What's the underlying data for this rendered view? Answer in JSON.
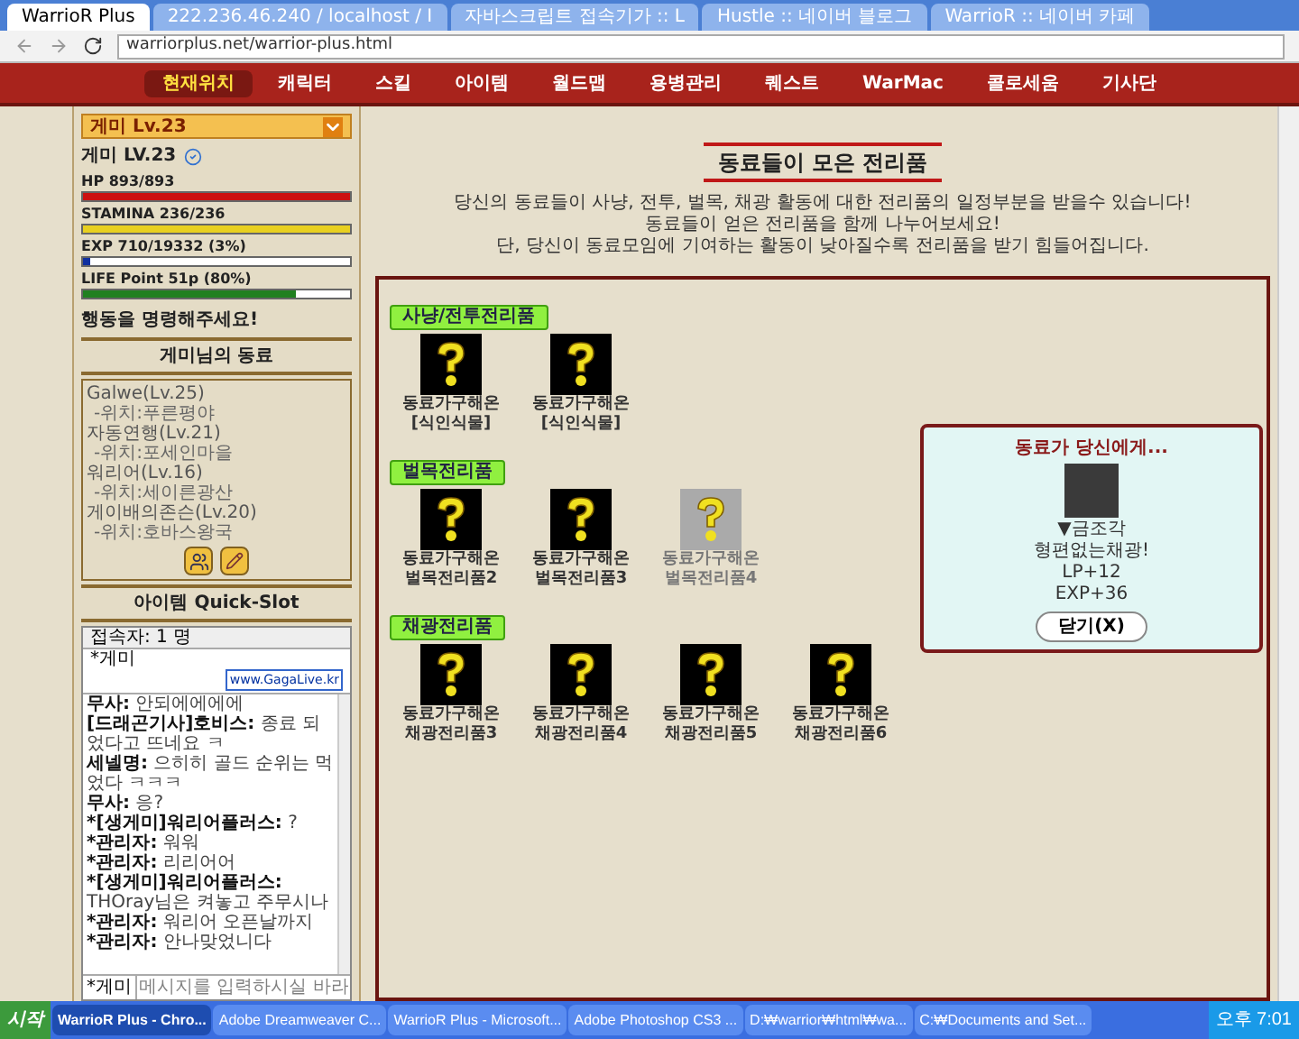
{
  "browser": {
    "tabs": [
      {
        "label": "WarrioR Plus",
        "selected": true
      },
      {
        "label": "222.236.46.240 / localhost / I",
        "selected": false
      },
      {
        "label": "자바스크립트 접속기가 :: L",
        "selected": false
      },
      {
        "label": "Hustle :: 네이버 블로그",
        "selected": false
      },
      {
        "label": "WarrioR :: 네이버 카페",
        "selected": false
      }
    ],
    "address": "warriorplus.net/warrior-plus.html"
  },
  "nav": [
    {
      "label": "현재위치",
      "selected": true
    },
    {
      "label": "캐릭터",
      "selected": false
    },
    {
      "label": "스킬",
      "selected": false
    },
    {
      "label": "아이템",
      "selected": false
    },
    {
      "label": "월드맵",
      "selected": false
    },
    {
      "label": "용병관리",
      "selected": false
    },
    {
      "label": "퀘스트",
      "selected": false
    },
    {
      "label": "WarMac",
      "selected": false
    },
    {
      "label": "콜로세움",
      "selected": false
    },
    {
      "label": "기사단",
      "selected": false
    }
  ],
  "sidebar": {
    "character_select": "게미 Lv.23",
    "name": "게미 LV.23",
    "stats": [
      {
        "label": "HP 893/893",
        "level": 1,
        "color": "#cc1010"
      },
      {
        "label": "STAMINA 236/236",
        "level": 1,
        "color": "#e8d020"
      },
      {
        "label": "EXP 710/19332 (3%)",
        "level": 0.03,
        "color": "#1030a0"
      },
      {
        "label": "LIFE Point 51p (80%)",
        "level": 0.8,
        "color": "#208020"
      }
    ],
    "command": "행동을 명령해주세요!",
    "companions_title": "게미님의 동료",
    "companions": [
      {
        "name": "Galwe(Lv.25)",
        "location": "-위치:푸른평야"
      },
      {
        "name": "자동연행(Lv.21)",
        "location": "-위치:포세인마을"
      },
      {
        "name": "워리어(Lv.16)",
        "location": "-위치:세이른광산"
      },
      {
        "name": "게이배의존슨(Lv.20)",
        "location": "-위치:호바스왕국"
      }
    ],
    "quickslot_title": "아이템 Quick-Slot",
    "chat": {
      "users_count": "접속자: 1 명",
      "users": [
        "*게미"
      ],
      "badge": "www.GagaLive.kr",
      "messages": [
        {
          "name": "무사:",
          "text": "안되에에에에"
        },
        {
          "name": "[드래곤기사]호비스:",
          "text": "종료 되었다고 뜨네요 ㅋ"
        },
        {
          "name": "세넬명:",
          "text": "으히히 골드 순위는 먹었다 ㅋㅋㅋ"
        },
        {
          "name": "무사:",
          "text": "응?"
        },
        {
          "name": "*[생게미]워리어플러스:",
          "text": "?"
        },
        {
          "name": "*관리자:",
          "text": "워워"
        },
        {
          "name": "*관리자:",
          "text": "리리어어"
        },
        {
          "name": "*[생게미]워리어플러스:",
          "text": "THOray님은 켜놓고 주무시나"
        },
        {
          "name": "*관리자:",
          "text": "워리어 오픈날까지"
        },
        {
          "name": "*관리자:",
          "text": "안나맞었니다"
        }
      ],
      "nick": "*게미",
      "placeholder": "메시지를 입력하시실 바라"
    }
  },
  "main": {
    "title": "동료들이 모은 전리품",
    "description": [
      "당신의 동료들이 사냥, 전투, 벌목, 채광 활동에 대한 전리품의 일정부분을 받을수 있습니다!",
      "동료들이 얻은 전리품을 함께 나누어보세요!",
      "단, 당신이 동료모임에 기여하는 활동이 낮아질수록 전리품을 받기 힘들어집니다."
    ],
    "sections": [
      {
        "title": "사냥/전투전리품",
        "items": [
          {
            "line1": "동료가구해온",
            "line2": "[식인식물]",
            "dimmed": false
          },
          {
            "line1": "동료가구해온",
            "line2": "[식인식물]",
            "dimmed": false
          }
        ]
      },
      {
        "title": "벌목전리품",
        "items": [
          {
            "line1": "동료가구해온",
            "line2": "벌목전리품2",
            "dimmed": false
          },
          {
            "line1": "동료가구해온",
            "line2": "벌목전리품3",
            "dimmed": false
          },
          {
            "line1": "동료가구해온",
            "line2": "벌목전리품4",
            "dimmed": true
          }
        ]
      },
      {
        "title": "채광전리품",
        "items": [
          {
            "line1": "동료가구해온",
            "line2": "채광전리품3",
            "dimmed": false
          },
          {
            "line1": "동료가구해온",
            "line2": "채광전리품4",
            "dimmed": false
          },
          {
            "line1": "동료가구해온",
            "line2": "채광전리품5",
            "dimmed": false
          },
          {
            "line1": "동료가구해온",
            "line2": "채광전리품6",
            "dimmed": false
          }
        ]
      }
    ],
    "popup": {
      "title": "동료가 당신에게...",
      "lines": [
        "▼금조각",
        "형편없는채광!",
        "LP+12",
        "EXP+36"
      ],
      "button": "닫기(X)"
    }
  },
  "taskbar": {
    "start": "시작",
    "tasks": [
      {
        "label": "WarrioR Plus - Chro...",
        "selected": true
      },
      {
        "label": "Adobe Dreamweaver C...",
        "selected": false
      },
      {
        "label": "WarrioR Plus - Microsoft...",
        "selected": false
      },
      {
        "label": "Adobe Photoshop CS3 ...",
        "selected": false
      },
      {
        "label": "D:₩warrior₩html₩wa...",
        "selected": false
      },
      {
        "label": "C:₩Documents and Set...",
        "selected": false
      }
    ],
    "clock": "오후 7:01"
  }
}
